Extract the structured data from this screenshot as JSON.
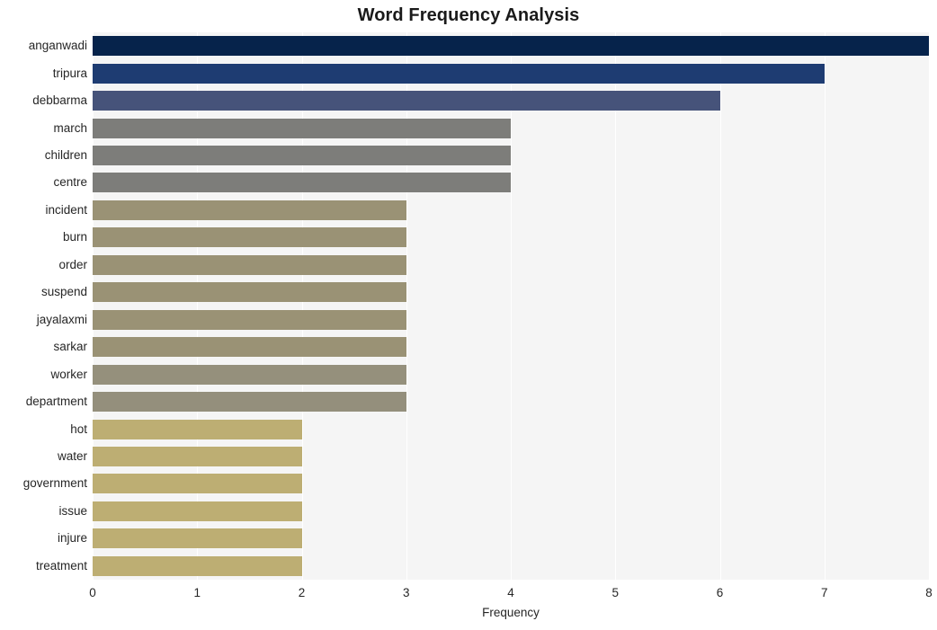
{
  "chart_data": {
    "type": "bar",
    "orientation": "horizontal",
    "title": "Word Frequency Analysis",
    "xlabel": "Frequency",
    "ylabel": "",
    "categories": [
      "anganwadi",
      "tripura",
      "debbarma",
      "march",
      "children",
      "centre",
      "incident",
      "burn",
      "order",
      "suspend",
      "jayalaxmi",
      "sarkar",
      "worker",
      "department",
      "hot",
      "water",
      "government",
      "issue",
      "injure",
      "treatment"
    ],
    "values": [
      8,
      7,
      6,
      4,
      4,
      4,
      3,
      3,
      3,
      3,
      3,
      3,
      3,
      3,
      2,
      2,
      2,
      2,
      2,
      2
    ],
    "bar_colors": [
      "#06234b",
      "#1e3c72",
      "#46537a",
      "#7d7d7a",
      "#7d7d7a",
      "#7d7d7a",
      "#9a9275",
      "#9a9275",
      "#9a9275",
      "#9a9275",
      "#9a9275",
      "#9a9275",
      "#95907c",
      "#948f7c",
      "#bdae73",
      "#bdae73",
      "#bdae73",
      "#bdae73",
      "#bdae73",
      "#bdae73"
    ],
    "xlim": [
      0,
      8
    ],
    "xticks": [
      0,
      1,
      2,
      3,
      4,
      5,
      6,
      7,
      8
    ],
    "xtick_labels": [
      "0",
      "1",
      "2",
      "3",
      "4",
      "5",
      "6",
      "7",
      "8"
    ],
    "grid": true,
    "grid_axis": "x",
    "grid_color": "#ffffff",
    "plot_background": "#f5f5f5",
    "figure_background": "#ffffff",
    "legend": null
  }
}
